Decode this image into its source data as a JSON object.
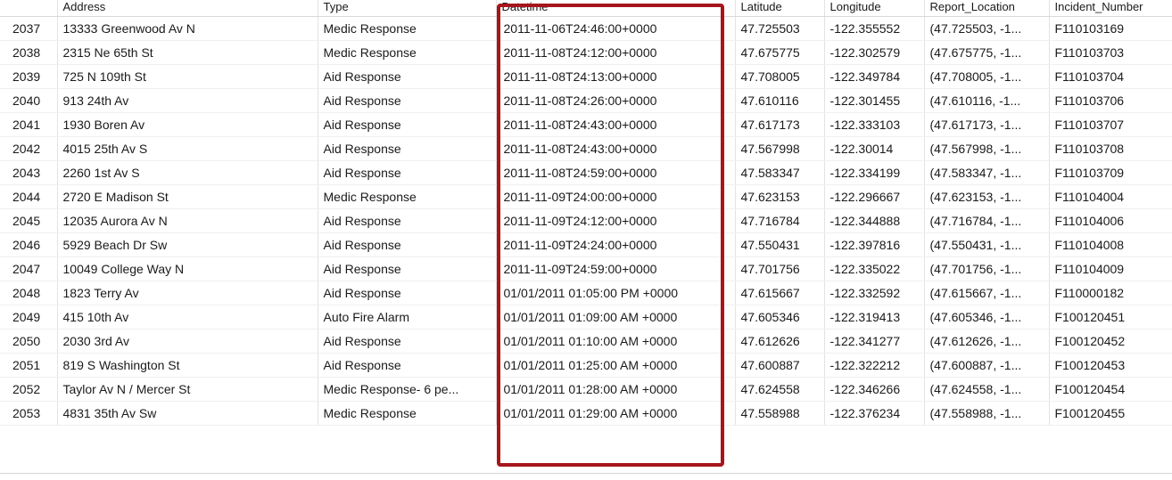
{
  "table": {
    "columns": [
      "",
      "Address",
      "Type",
      "Datetime",
      "Latitude",
      "Longitude",
      "Report_Location",
      "Incident_Number"
    ],
    "rows": [
      [
        "2037",
        "13333 Greenwood Av N",
        "Medic Response",
        "2011-11-06T24:46:00+0000",
        "47.725503",
        "-122.355552",
        "(47.725503, -1...",
        "F110103169"
      ],
      [
        "2038",
        "2315 Ne 65th St",
        "Medic Response",
        "2011-11-08T24:12:00+0000",
        "47.675775",
        "-122.302579",
        "(47.675775, -1...",
        "F110103703"
      ],
      [
        "2039",
        "725 N 109th St",
        "Aid Response",
        "2011-11-08T24:13:00+0000",
        "47.708005",
        "-122.349784",
        "(47.708005, -1...",
        "F110103704"
      ],
      [
        "2040",
        "913 24th Av",
        "Aid Response",
        "2011-11-08T24:26:00+0000",
        "47.610116",
        "-122.301455",
        "(47.610116, -1...",
        "F110103706"
      ],
      [
        "2041",
        "1930 Boren Av",
        "Aid Response",
        "2011-11-08T24:43:00+0000",
        "47.617173",
        "-122.333103",
        "(47.617173, -1...",
        "F110103707"
      ],
      [
        "2042",
        "4015 25th Av S",
        "Aid Response",
        "2011-11-08T24:43:00+0000",
        "47.567998",
        "-122.30014",
        "(47.567998, -1...",
        "F110103708"
      ],
      [
        "2043",
        "2260 1st Av S",
        "Aid Response",
        "2011-11-08T24:59:00+0000",
        "47.583347",
        "-122.334199",
        "(47.583347, -1...",
        "F110103709"
      ],
      [
        "2044",
        "2720 E Madison St",
        "Medic Response",
        "2011-11-09T24:00:00+0000",
        "47.623153",
        "-122.296667",
        "(47.623153, -1...",
        "F110104004"
      ],
      [
        "2045",
        "12035 Aurora Av N",
        "Aid Response",
        "2011-11-09T24:12:00+0000",
        "47.716784",
        "-122.344888",
        "(47.716784, -1...",
        "F110104006"
      ],
      [
        "2046",
        "5929 Beach Dr Sw",
        "Aid Response",
        "2011-11-09T24:24:00+0000",
        "47.550431",
        "-122.397816",
        "(47.550431, -1...",
        "F110104008"
      ],
      [
        "2047",
        "10049 College Way N",
        "Aid Response",
        "2011-11-09T24:59:00+0000",
        "47.701756",
        "-122.335022",
        "(47.701756, -1...",
        "F110104009"
      ],
      [
        "2048",
        "1823 Terry Av",
        "Aid Response",
        "01/01/2011 01:05:00 PM +0000",
        "47.615667",
        "-122.332592",
        "(47.615667, -1...",
        "F110000182"
      ],
      [
        "2049",
        "415 10th Av",
        "Auto Fire Alarm",
        "01/01/2011 01:09:00 AM +0000",
        "47.605346",
        "-122.319413",
        "(47.605346, -1...",
        "F100120451"
      ],
      [
        "2050",
        "2030 3rd Av",
        "Aid Response",
        "01/01/2011 01:10:00 AM +0000",
        "47.612626",
        "-122.341277",
        "(47.612626, -1...",
        "F100120452"
      ],
      [
        "2051",
        "819 S Washington St",
        "Aid Response",
        "01/01/2011 01:25:00 AM +0000",
        "47.600887",
        "-122.322212",
        "(47.600887, -1...",
        "F100120453"
      ],
      [
        "2052",
        "Taylor Av N / Mercer St",
        "Medic Response- 6 pe...",
        "01/01/2011 01:28:00 AM +0000",
        "47.624558",
        "-122.346266",
        "(47.624558, -1...",
        "F100120454"
      ],
      [
        "2053",
        "4831 35th Av Sw",
        "Medic Response",
        "01/01/2011 01:29:00 AM +0000",
        "47.558988",
        "-122.376234",
        "(47.558988, -1...",
        "F100120455"
      ]
    ]
  },
  "highlight": {
    "color": "#a6161b",
    "target_column": "Datetime"
  }
}
